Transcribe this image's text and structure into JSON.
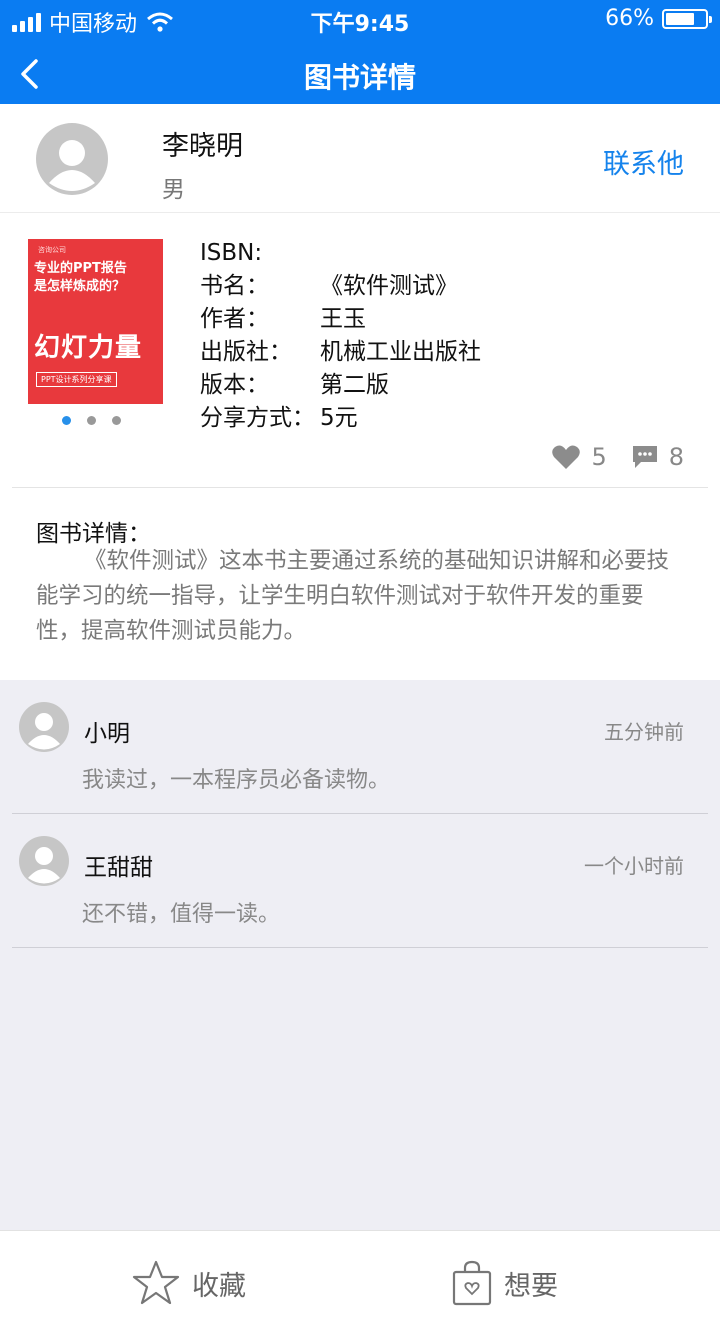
{
  "status": {
    "carrier": "中国移动",
    "time": "下午9:45",
    "battery": "66%",
    "battery_level": 0.66
  },
  "nav": {
    "title": "图书详情",
    "back_icon": "chevron-left-icon"
  },
  "owner": {
    "name": "李晓明",
    "gender": "男",
    "contact": "联系他"
  },
  "book": {
    "cover": {
      "line1": "咨询公司",
      "line2": "专业的PPT报告",
      "line3": "是怎样炼成的？",
      "line4": "幻灯力量",
      "line5": "PPT设计系列分享课"
    },
    "fields": [
      {
        "label": "ISBN:",
        "value": ""
      },
      {
        "label": "书名：",
        "value": "《软件测试》"
      },
      {
        "label": "作者：",
        "value": "王玉"
      },
      {
        "label": "出版社：",
        "value": "机械工业出版社"
      },
      {
        "label": "版本：",
        "value": "第二版"
      },
      {
        "label": "分享方式：",
        "value": "5元"
      }
    ],
    "likes": "5",
    "comments_count": "8"
  },
  "detail": {
    "title": "图书详情：",
    "text": "《软件测试》这本书主要通过系统的基础知识讲解和必要技能学习的统一指导，让学生明白软件测试对于软件开发的重要性，提高软件测试员能力。"
  },
  "comments": [
    {
      "name": "小明",
      "time": "五分钟前",
      "text": "我读过，一本程序员必备读物。"
    },
    {
      "name": "王甜甜",
      "time": "一个小时前",
      "text": "还不错，值得一读。"
    }
  ],
  "actions": {
    "favorite": "收藏",
    "want": "想要"
  },
  "colors": {
    "primary": "#0a7cf2",
    "link": "#1583ec",
    "cover": "#e8393d",
    "comment_bg": "#eeeef4"
  }
}
